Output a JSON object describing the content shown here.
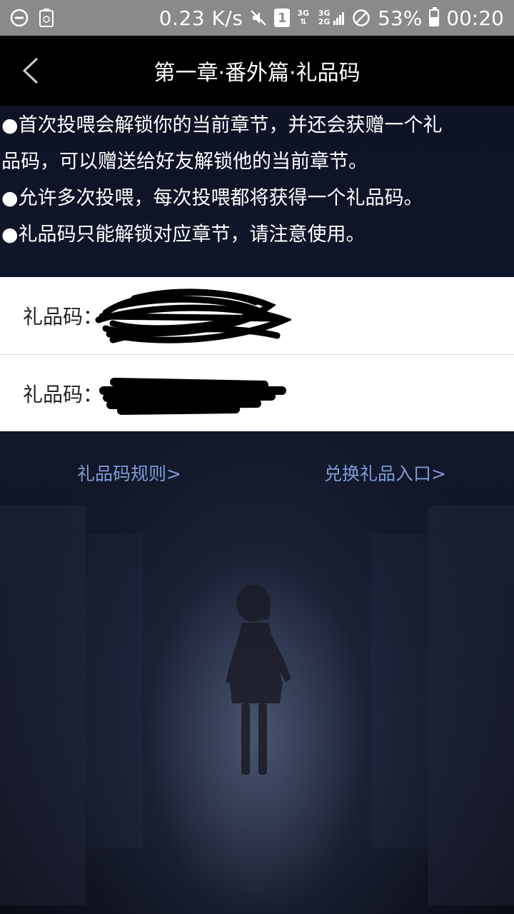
{
  "status_bar": {
    "net_speed": "0.23 K/s",
    "sim_slot": "1",
    "net_type_top": "3G",
    "net_type_bottom": "3G 2G",
    "battery_percent": "53%",
    "battery_level": 0.53,
    "time": "00:20",
    "icons": [
      "minus-circle-icon",
      "recycle-icon",
      "mute-icon",
      "signal-icon",
      "blocked-icon",
      "battery-icon"
    ]
  },
  "nav": {
    "title": "第一章·番外篇·礼品码",
    "back_icon": "chevron-left-icon"
  },
  "rules": [
    "●首次投喂会解锁你的当前章节，并还会获赠一个礼",
    "品码，可以赠送给好友解锁他的当前章节。",
    "●允许多次投喂，每次投喂都将获得一个礼品码。",
    "●礼品码只能解锁对应章节，请注意使用。"
  ],
  "gift_codes": [
    {
      "label": "礼品码："
    },
    {
      "label": "礼品码："
    }
  ],
  "links": {
    "rules": "礼品码规则>",
    "exchange": "兑换礼品入口>"
  },
  "colors": {
    "status_bar": "#8a8a8a",
    "nav_bar": "#000000",
    "link": "#7f9bd6",
    "panel": "#ffffff"
  }
}
